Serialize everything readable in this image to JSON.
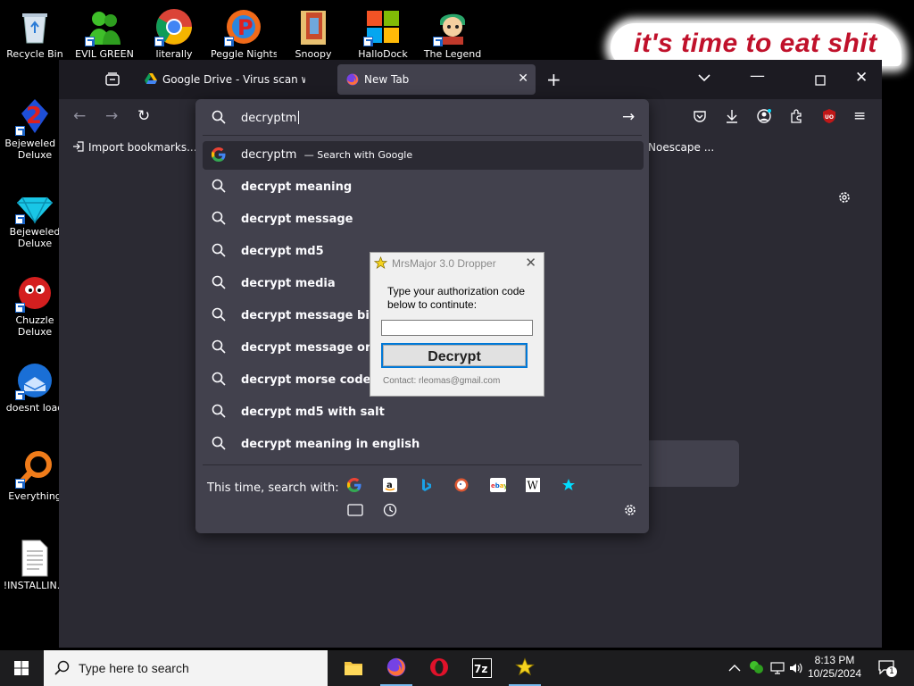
{
  "desktop": {
    "icons": [
      {
        "label": "Recycle Bin"
      },
      {
        "label": "EVIL GREEN"
      },
      {
        "label": "literally"
      },
      {
        "label": "Peggle Nights"
      },
      {
        "label": "Snoopy"
      },
      {
        "label": "HalloDock"
      },
      {
        "label": "The Legend"
      },
      {
        "label": "Bejeweled 2 Deluxe"
      },
      {
        "label": "Bejeweled Deluxe"
      },
      {
        "label": "Chuzzle Deluxe"
      },
      {
        "label": "doesnt load"
      },
      {
        "label": "Everything"
      },
      {
        "label": "!INSTALLIN..."
      }
    ],
    "meme_text": "it's time to eat shit"
  },
  "browser": {
    "tabs": [
      {
        "title": "Google Drive - Virus scan warning"
      },
      {
        "title": "New Tab"
      }
    ],
    "bookmarks": {
      "import": "Import bookmarks...",
      "right": "Noescape ..."
    },
    "urlbar": {
      "value": "decryptm",
      "first": {
        "text": "decryptm",
        "hint": "— Search with Google"
      },
      "suggestions": [
        "decrypt meaning",
        "decrypt message",
        "decrypt md5",
        "decrypt media",
        "decrypt message bitlocker",
        "decrypt message online",
        "decrypt morse code",
        "decrypt md5 with salt",
        "decrypt meaning in english"
      ],
      "onesearch_label": "This time, search with:"
    },
    "colors": {
      "accent": "#00ddff",
      "ublock": "#c01818"
    }
  },
  "dialog": {
    "title": "MrsMajor 3.0 Dropper",
    "message": "Type your authorization code below to continute:",
    "input_value": "",
    "button": "Decrypt",
    "contact": "Contact: rleomas@gmail.com"
  },
  "taskbar": {
    "search_placeholder": "Type here to search",
    "time": "8:13 PM",
    "date": "10/25/2024",
    "notification_count": "1"
  }
}
